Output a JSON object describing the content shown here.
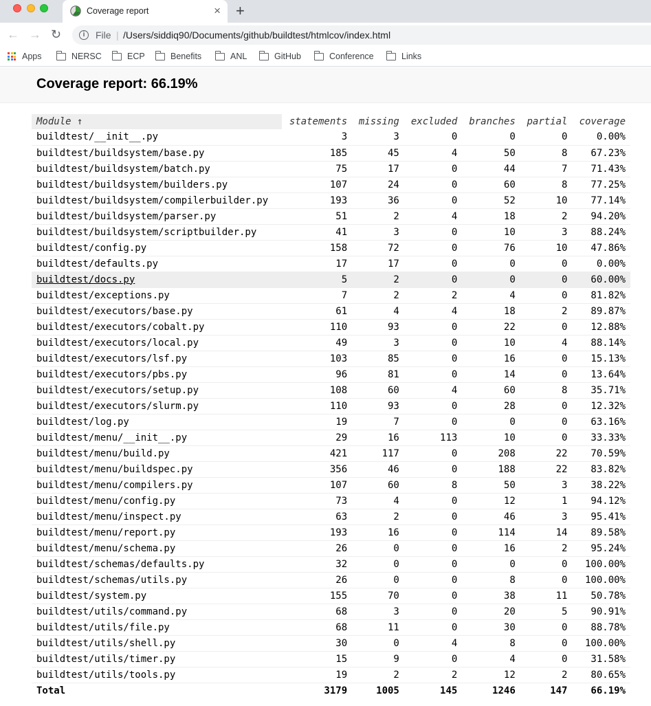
{
  "browser": {
    "tab_title": "Coverage report",
    "tab_close": "×",
    "new_tab": "+",
    "nav": {
      "back": "←",
      "forward": "→",
      "reload": "↻"
    },
    "address": {
      "info": "i",
      "scheme": "File",
      "separator": "|",
      "url": "/Users/siddiq90/Documents/github/buildtest/htmlcov/index.html"
    },
    "bookmarks": [
      {
        "label": "Apps",
        "icon": "apps-grid-icon"
      },
      {
        "label": "NERSC",
        "icon": "folder-icon"
      },
      {
        "label": "ECP",
        "icon": "folder-icon"
      },
      {
        "label": "Benefits",
        "icon": "folder-icon"
      },
      {
        "label": "ANL",
        "icon": "folder-icon"
      },
      {
        "label": "GitHub",
        "icon": "folder-icon"
      },
      {
        "label": "Conference",
        "icon": "folder-icon"
      },
      {
        "label": "Links",
        "icon": "folder-icon"
      }
    ],
    "colors": {
      "apps_grid": [
        "#ea4335",
        "#fbbc05",
        "#34a853",
        "#4285f4",
        "#ea4335",
        "#fbbc05",
        "#34a853",
        "#4285f4",
        "#ea4335"
      ]
    }
  },
  "report": {
    "title": "Coverage report: 66.19%",
    "columns": [
      "Module ↑",
      "statements",
      "missing",
      "excluded",
      "branches",
      "partial",
      "coverage"
    ],
    "highlighted_row": 9,
    "rows": [
      [
        "buildtest/__init__.py",
        "3",
        "3",
        "0",
        "0",
        "0",
        "0.00%"
      ],
      [
        "buildtest/buildsystem/base.py",
        "185",
        "45",
        "4",
        "50",
        "8",
        "67.23%"
      ],
      [
        "buildtest/buildsystem/batch.py",
        "75",
        "17",
        "0",
        "44",
        "7",
        "71.43%"
      ],
      [
        "buildtest/buildsystem/builders.py",
        "107",
        "24",
        "0",
        "60",
        "8",
        "77.25%"
      ],
      [
        "buildtest/buildsystem/compilerbuilder.py",
        "193",
        "36",
        "0",
        "52",
        "10",
        "77.14%"
      ],
      [
        "buildtest/buildsystem/parser.py",
        "51",
        "2",
        "4",
        "18",
        "2",
        "94.20%"
      ],
      [
        "buildtest/buildsystem/scriptbuilder.py",
        "41",
        "3",
        "0",
        "10",
        "3",
        "88.24%"
      ],
      [
        "buildtest/config.py",
        "158",
        "72",
        "0",
        "76",
        "10",
        "47.86%"
      ],
      [
        "buildtest/defaults.py",
        "17",
        "17",
        "0",
        "0",
        "0",
        "0.00%"
      ],
      [
        "buildtest/docs.py",
        "5",
        "2",
        "0",
        "0",
        "0",
        "60.00%"
      ],
      [
        "buildtest/exceptions.py",
        "7",
        "2",
        "2",
        "4",
        "0",
        "81.82%"
      ],
      [
        "buildtest/executors/base.py",
        "61",
        "4",
        "4",
        "18",
        "2",
        "89.87%"
      ],
      [
        "buildtest/executors/cobalt.py",
        "110",
        "93",
        "0",
        "22",
        "0",
        "12.88%"
      ],
      [
        "buildtest/executors/local.py",
        "49",
        "3",
        "0",
        "10",
        "4",
        "88.14%"
      ],
      [
        "buildtest/executors/lsf.py",
        "103",
        "85",
        "0",
        "16",
        "0",
        "15.13%"
      ],
      [
        "buildtest/executors/pbs.py",
        "96",
        "81",
        "0",
        "14",
        "0",
        "13.64%"
      ],
      [
        "buildtest/executors/setup.py",
        "108",
        "60",
        "4",
        "60",
        "8",
        "35.71%"
      ],
      [
        "buildtest/executors/slurm.py",
        "110",
        "93",
        "0",
        "28",
        "0",
        "12.32%"
      ],
      [
        "buildtest/log.py",
        "19",
        "7",
        "0",
        "0",
        "0",
        "63.16%"
      ],
      [
        "buildtest/menu/__init__.py",
        "29",
        "16",
        "113",
        "10",
        "0",
        "33.33%"
      ],
      [
        "buildtest/menu/build.py",
        "421",
        "117",
        "0",
        "208",
        "22",
        "70.59%"
      ],
      [
        "buildtest/menu/buildspec.py",
        "356",
        "46",
        "0",
        "188",
        "22",
        "83.82%"
      ],
      [
        "buildtest/menu/compilers.py",
        "107",
        "60",
        "8",
        "50",
        "3",
        "38.22%"
      ],
      [
        "buildtest/menu/config.py",
        "73",
        "4",
        "0",
        "12",
        "1",
        "94.12%"
      ],
      [
        "buildtest/menu/inspect.py",
        "63",
        "2",
        "0",
        "46",
        "3",
        "95.41%"
      ],
      [
        "buildtest/menu/report.py",
        "193",
        "16",
        "0",
        "114",
        "14",
        "89.58%"
      ],
      [
        "buildtest/menu/schema.py",
        "26",
        "0",
        "0",
        "16",
        "2",
        "95.24%"
      ],
      [
        "buildtest/schemas/defaults.py",
        "32",
        "0",
        "0",
        "0",
        "0",
        "100.00%"
      ],
      [
        "buildtest/schemas/utils.py",
        "26",
        "0",
        "0",
        "8",
        "0",
        "100.00%"
      ],
      [
        "buildtest/system.py",
        "155",
        "70",
        "0",
        "38",
        "11",
        "50.78%"
      ],
      [
        "buildtest/utils/command.py",
        "68",
        "3",
        "0",
        "20",
        "5",
        "90.91%"
      ],
      [
        "buildtest/utils/file.py",
        "68",
        "11",
        "0",
        "30",
        "0",
        "88.78%"
      ],
      [
        "buildtest/utils/shell.py",
        "30",
        "0",
        "4",
        "8",
        "0",
        "100.00%"
      ],
      [
        "buildtest/utils/timer.py",
        "15",
        "9",
        "0",
        "4",
        "0",
        "31.58%"
      ],
      [
        "buildtest/utils/tools.py",
        "19",
        "2",
        "2",
        "12",
        "2",
        "80.65%"
      ]
    ],
    "total": [
      "Total",
      "3179",
      "1005",
      "145",
      "1246",
      "147",
      "66.19%"
    ]
  }
}
